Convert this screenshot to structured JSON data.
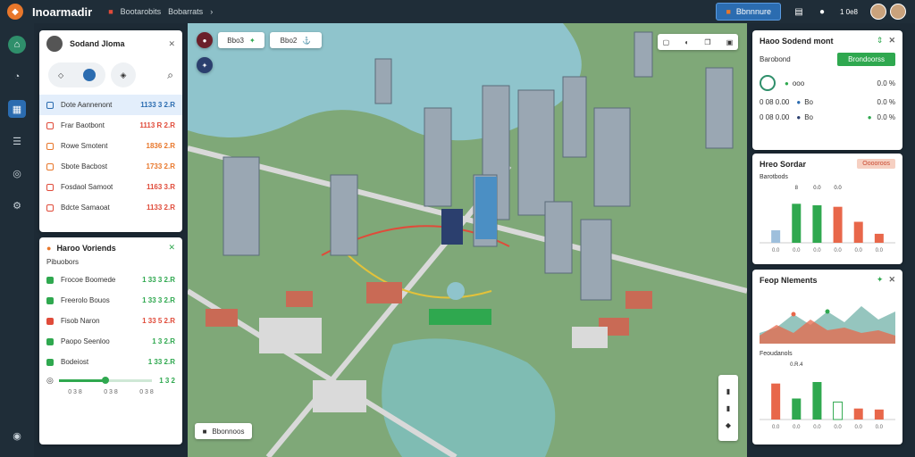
{
  "app": {
    "title": "Inoarmadir"
  },
  "breadcrumb": [
    "Bootarobits",
    "Bobarrats"
  ],
  "topbar": {
    "primary_btn": "Bbnnnure",
    "user_label": "1 0e8"
  },
  "layers_panel": {
    "title": "Sodand Jloma",
    "items": [
      {
        "label": "Dote Aannenont",
        "value": "1133 3 2.R",
        "color": "blue",
        "icon": "layer-icon",
        "highlight": true
      },
      {
        "label": "Frar Baotbont",
        "value": "1113 R 2.R",
        "color": "red",
        "icon": "layer-icon"
      },
      {
        "label": "Rowe Smotent",
        "value": "1836 2.R",
        "color": "orange",
        "icon": "layer-icon"
      },
      {
        "label": "Sbote Bacbost",
        "value": "1733 2.R",
        "color": "orange",
        "icon": "layer-icon"
      },
      {
        "label": "Fosdaol Samoot",
        "value": "1163 3.R",
        "color": "red",
        "icon": "layer-icon"
      },
      {
        "label": "Bdcte Samaoat",
        "value": "1133 2.R",
        "color": "red",
        "icon": "layer-icon"
      }
    ]
  },
  "metrics_panel": {
    "title": "Haroo Voriends",
    "subtitle": "Pibuobors",
    "items": [
      {
        "label": "Frocoe Boomede",
        "value": "1 33 3 2.R",
        "color": "green"
      },
      {
        "label": "Freerolo Bouos",
        "value": "1 33 3 2.R",
        "color": "green"
      },
      {
        "label": "Fisob Naron",
        "value": "1 33 5 2.R",
        "color": "red"
      },
      {
        "label": "Paopo Seenloo",
        "value": "1 3 2.R",
        "color": "green"
      },
      {
        "label": "Bodeiost",
        "value": "1 33 2.R",
        "color": "green"
      }
    ],
    "slider_value": "1 3 2",
    "slider_fraction": 0.5,
    "slider_ticks": [
      "0 3 8",
      "0 3 8",
      "0 3 8"
    ]
  },
  "map": {
    "chips": [
      "Bbo3",
      "Bbo2"
    ],
    "toolbar_icons": [
      "layers-icon",
      "pin-icon",
      "copy-icon",
      "expand-icon"
    ],
    "bottom_btn": "Bbonnoos",
    "zoom_icons": [
      "zoom-in-icon",
      "zoom-out-icon",
      "compass-icon"
    ]
  },
  "right_top": {
    "title": "Haoo Sodend mont",
    "btn": "Brondoorss",
    "subtitle": "Barobond",
    "rows": [
      {
        "a": "Ooo",
        "b": "ooo",
        "c": "0.0 %"
      },
      {
        "a": "0 08 0.00",
        "b": "Bo",
        "c": "0.0 %"
      },
      {
        "a": "0 08 0.00",
        "b": "Bo",
        "c": "0.0 %"
      }
    ]
  },
  "right_mid": {
    "title": "Hreo Sordar",
    "badge": "Ooooroos",
    "subtitle": "Barotbods",
    "labels": [
      "8",
      "0.0",
      "0.0"
    ]
  },
  "right_bottom": {
    "title": "Feop Nlements",
    "subtitle": "Feoudanols",
    "label": "0.R.4"
  },
  "chart_data": [
    {
      "type": "bar",
      "categories": [
        "0.0",
        "0.0",
        "0.0",
        "0.0",
        "0.0",
        "0.0"
      ],
      "values": [
        25,
        78,
        75,
        72,
        42,
        18
      ],
      "colors": [
        "#9ebfdc",
        "#2fa84f",
        "#2fa84f",
        "#e8674a",
        "#e8674a",
        "#e8674a"
      ],
      "ylim": [
        0,
        100
      ]
    },
    {
      "type": "area",
      "x": [
        0,
        1,
        2,
        3,
        4,
        5,
        6,
        7,
        8
      ],
      "series": [
        {
          "values": [
            20,
            30,
            55,
            35,
            60,
            40,
            70,
            45,
            60
          ],
          "color": "#4f9e93"
        },
        {
          "values": [
            15,
            35,
            20,
            45,
            25,
            30,
            20,
            25,
            15
          ],
          "color": "#e8674a"
        }
      ],
      "ylim": [
        0,
        100
      ]
    },
    {
      "type": "bar",
      "categories": [
        "0.0",
        "0.0",
        "0.0",
        "0.0",
        "0.0",
        "0.0"
      ],
      "values": [
        72,
        42,
        75,
        35,
        22,
        20
      ],
      "colors": [
        "#e8674a",
        "#2fa84f",
        "#2fa84f",
        "#ffffff",
        "#e8674a",
        "#e8674a"
      ],
      "ylim": [
        0,
        100
      ]
    }
  ]
}
